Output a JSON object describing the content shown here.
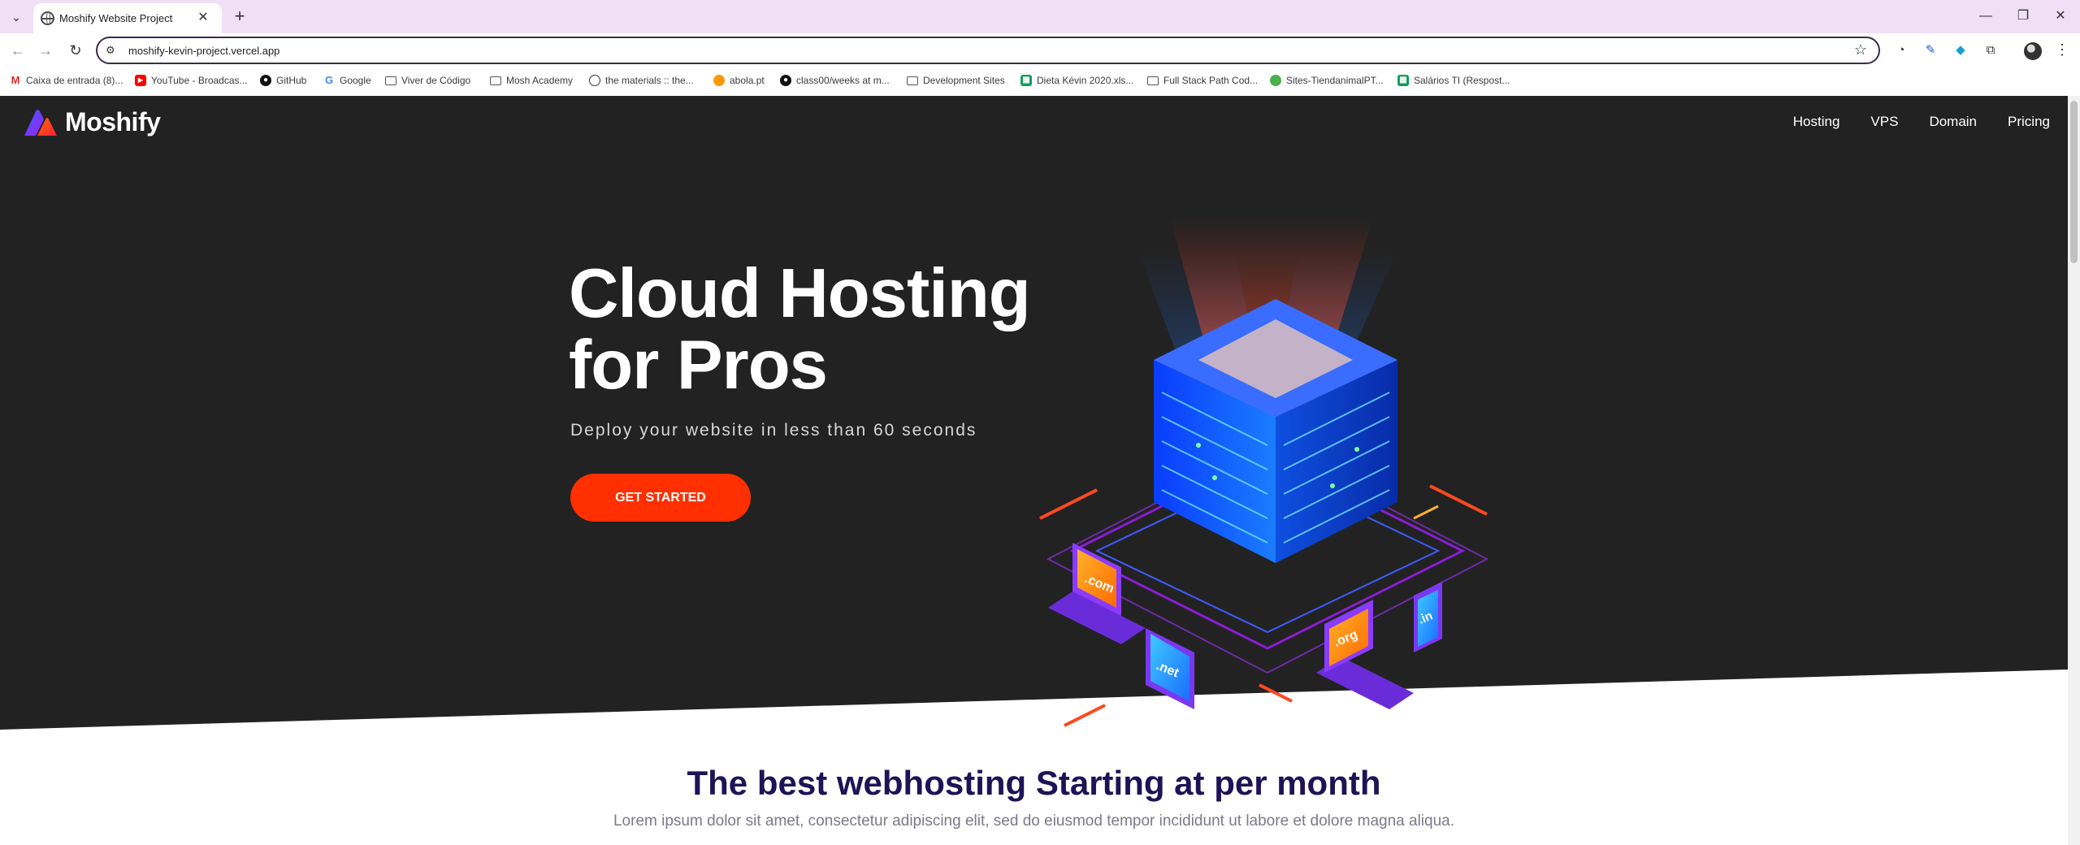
{
  "browser": {
    "tab_title": "Moshify Website Project",
    "url": "moshify-kevin-project.vercel.app",
    "bookmarks": [
      {
        "label": "Caixa de entrada (8)...",
        "icon": "gmail-icon",
        "color": "#d93025"
      },
      {
        "label": "YouTube - Broadcas...",
        "icon": "youtube-icon",
        "color": "#ff0000"
      },
      {
        "label": "GitHub",
        "icon": "github-icon",
        "color": "#111111"
      },
      {
        "label": "Google",
        "icon": "google-icon",
        "color": "#4285f4"
      },
      {
        "label": "Viver de Código",
        "icon": "folder-icon",
        "color": "#555555"
      },
      {
        "label": "Mosh Academy",
        "icon": "folder-icon",
        "color": "#555555"
      },
      {
        "label": "the materials :: the...",
        "icon": "globe-icon",
        "color": "#333333"
      },
      {
        "label": "abola.pt",
        "icon": "abola-icon",
        "color": "#e53935"
      },
      {
        "label": "class00/weeks at m...",
        "icon": "github-icon",
        "color": "#111111"
      },
      {
        "label": "Development Sites",
        "icon": "folder-icon",
        "color": "#555555"
      },
      {
        "label": "Dieta Kévin 2020.xls...",
        "icon": "sheets-icon",
        "color": "#0f9d58"
      },
      {
        "label": "Full Stack Path Cod...",
        "icon": "folder-icon",
        "color": "#555555"
      },
      {
        "label": "Sites-TiendanimalPT...",
        "icon": "sites-icon",
        "color": "#4caf50"
      },
      {
        "label": "Salários TI (Respost...",
        "icon": "sheets-icon",
        "color": "#0f9d58"
      }
    ]
  },
  "site": {
    "brand": "Moshify",
    "nav": [
      "Hosting",
      "VPS",
      "Domain",
      "Pricing"
    ],
    "hero": {
      "title_line1": "Cloud Hosting",
      "title_line2": "for Pros",
      "subtitle": "Deploy your website in less than 60 seconds",
      "cta": "GET STARTED"
    },
    "section": {
      "title": "The best webhosting Starting at per month",
      "text": "Lorem ipsum dolor sit amet, consectetur adipiscing elit, sed do eiusmod tempor incididunt ut labore et dolore magna aliqua."
    },
    "domains": [
      ".com",
      ".net",
      ".org",
      ".in"
    ]
  },
  "colors": {
    "hero_bg": "#222222",
    "cta": "#ff2f00",
    "heading": "#1e1356",
    "tab_strip": "#f0dff5"
  }
}
